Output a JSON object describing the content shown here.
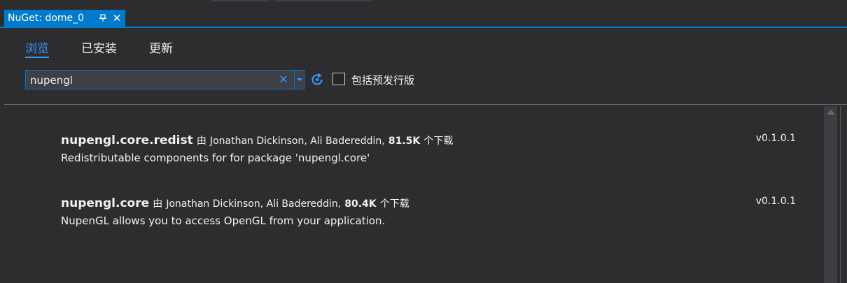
{
  "document_tab": {
    "title": "NuGet: dome_0",
    "pin_icon": "pin-icon",
    "close_icon": "close-icon"
  },
  "nav_tabs": [
    {
      "label": "浏览",
      "active": true
    },
    {
      "label": "已安装",
      "active": false
    },
    {
      "label": "更新",
      "active": false
    }
  ],
  "search": {
    "value": "nupengl",
    "clear_icon": "clear-icon",
    "dropdown_icon": "chevron-down-icon",
    "refresh_icon": "refresh-icon"
  },
  "prerelease": {
    "label": "包括预发行版",
    "checked": false
  },
  "packages": [
    {
      "name": "nupengl.core.redist",
      "by": "由",
      "authors": "Jonathan Dickinson, Ali Badereddin,",
      "downloads": "81.5K",
      "downloads_suffix": "个下载",
      "description": "Redistributable components for for package 'nupengl.core'",
      "version": "v0.1.0.1"
    },
    {
      "name": "nupengl.core",
      "by": "由",
      "authors": "Jonathan Dickinson, Ali Badereddin,",
      "downloads": "80.4K",
      "downloads_suffix": "个下载",
      "description": "NupenGL allows you to access OpenGL from your application.",
      "version": "v0.1.0.1"
    }
  ],
  "colors": {
    "accent": "#007acc",
    "link_active": "#3399ff",
    "background": "#2d2d30"
  }
}
